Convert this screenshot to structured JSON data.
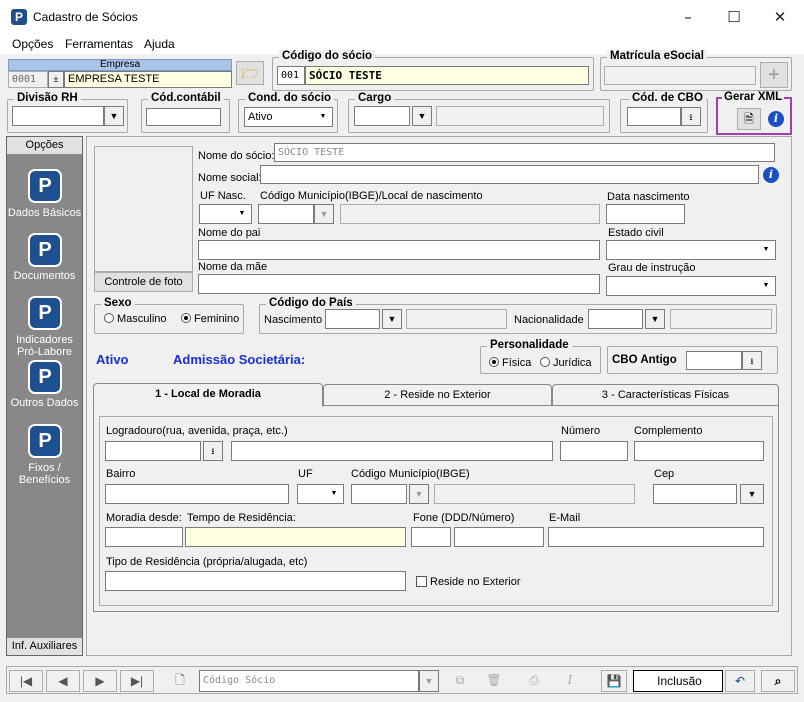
{
  "window": {
    "title": "Cadastro de Sócios",
    "minimize": "–",
    "maximize": "☐",
    "close": "✕"
  },
  "menu": [
    "Opções",
    "Ferramentas",
    "Ajuda"
  ],
  "empresa": {
    "label": "Empresa",
    "code": "0001",
    "name": "EMPRESA TESTE"
  },
  "codigo_socio": {
    "label": "Código do sócio",
    "code": "001",
    "name": "SÓCIO TESTE"
  },
  "matricula": {
    "label": "Matrícula eSocial",
    "value": ""
  },
  "row2": {
    "divisao_label": "Divisão RH",
    "cod_contabil_label": "Cód.contábil",
    "cond_label": "Cond. do sócio",
    "cond_value": "Ativo",
    "cargo_label": "Cargo",
    "cbo_label": "Cód. de CBO",
    "gerar_label": "Gerar XML"
  },
  "sidebar": {
    "header": "Opções",
    "items": [
      "Dados Básicos",
      "Documentos",
      "Indicadores Pró-Labore",
      "Outros Dados",
      "Fixos / Benefícios"
    ],
    "footer": "Inf. Auxiliares"
  },
  "form": {
    "nome_label": "Nome do sócio:",
    "nome_value": "SÓCIO TESTE",
    "nome_social_label": "Nome social:",
    "uf_nasc_label": "UF Nasc.",
    "municipio_label": "Código Município(IBGE)/Local de nascimento",
    "data_nasc_label": "Data nascimento",
    "pai_label": "Nome do pai",
    "estado_civil_label": "Estado civil",
    "mae_label": "Nome da mãe",
    "grau_label": "Grau de instrução",
    "foto_button": "Controle de foto",
    "sexo_label": "Sexo",
    "masculino": "Masculino",
    "feminino": "Feminino",
    "pais_label": "Código do País",
    "nascimento_label": "Nascimento",
    "nacionalidade_label": "Nacionalidade",
    "status": "Ativo",
    "admissao": "Admissão Societária:",
    "personalidade_label": "Personalidade",
    "fisica": "Física",
    "juridica": "Jurídica",
    "cbo_antigo_label": "CBO Antigo"
  },
  "tabs": [
    "1 - Local de Moradia",
    "2 - Reside no Exterior",
    "3 - Características Físicas"
  ],
  "moradia": {
    "logradouro_label": "Logradouro(rua, avenida, praça, etc.)",
    "numero_label": "Número",
    "complemento_label": "Complemento",
    "bairro_label": "Bairro",
    "uf_label": "UF",
    "municipio_label": "Código Município(IBGE)",
    "cep_label": "Cep",
    "moradia_desde_label": "Moradia desde:",
    "tempo_label": "Tempo de Residência:",
    "fone_label": "Fone (DDD/Número)",
    "email_label": "E-Mail",
    "tipo_label": "Tipo de Residência  (própria/alugada, etc)",
    "reside_exterior_label": "Reside no Exterior"
  },
  "navbar": {
    "search_placeholder": "Código Sócio",
    "mode": "Inclusão"
  }
}
